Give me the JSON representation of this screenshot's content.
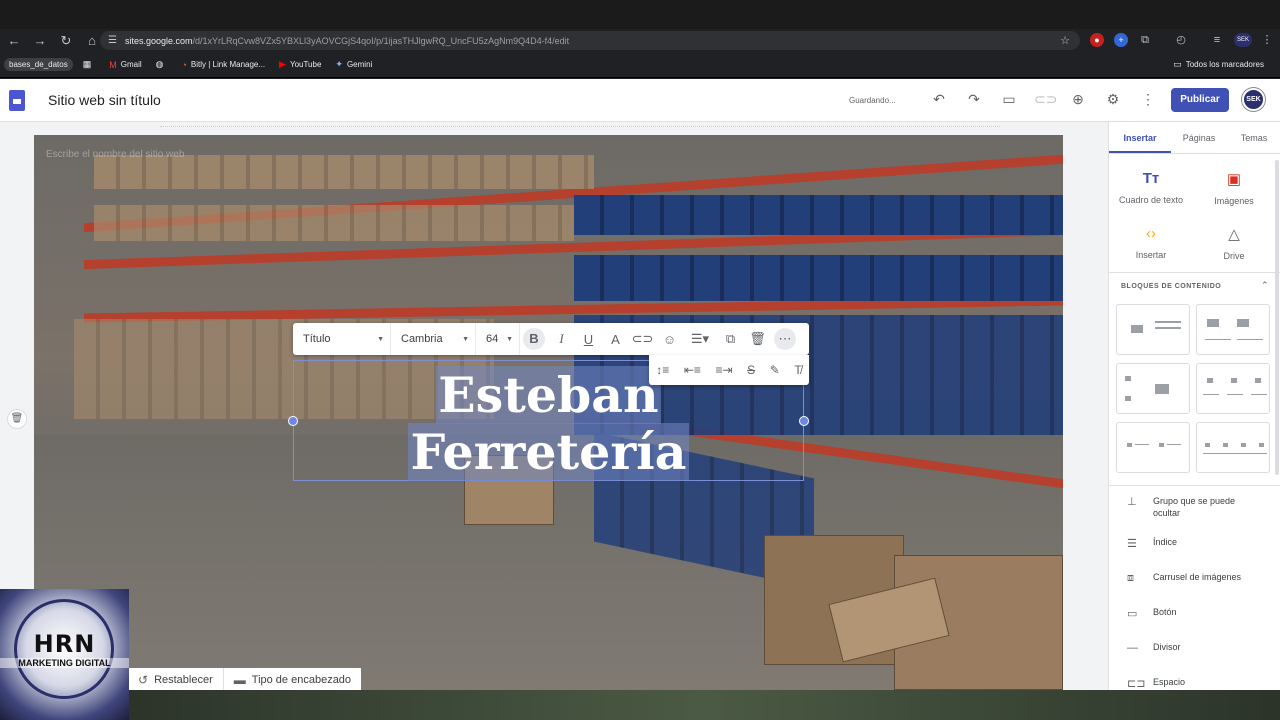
{
  "browser": {
    "url_host": "sites.google.com",
    "url_path": "/d/1xYrLRqCvw8VZx5YBXLl3yAOVCGjS4qoI/p/1ijasTHJlgwRQ_UncFU5zAgNm9Q4D4-f4/edit",
    "bookmarks": [
      "bases_de_datos",
      "Gmail",
      "Bitly | Link Manage...",
      "YouTube",
      "Gemini"
    ],
    "all_bookmarks": "Todos los marcadores",
    "avatar_text": "SEK"
  },
  "header": {
    "title": "Sitio web sin título",
    "status": "Guardando...",
    "publish": "Publicar",
    "avatar": "SEK"
  },
  "hero": {
    "site_name_placeholder": "Escribe el nombre del sitio web",
    "headline_line1": "Esteban",
    "headline_line2": "Ferretería"
  },
  "toolbar": {
    "style": "Título",
    "font": "Cambria",
    "size": "64"
  },
  "header_actions": {
    "reset": "Restablecer",
    "header_type": "Tipo de encabezado"
  },
  "panel": {
    "tabs": [
      "Insertar",
      "Páginas",
      "Temas"
    ],
    "insert_items": [
      "Cuadro de texto",
      "Imágenes",
      "Insertar",
      "Drive"
    ],
    "section_title": "BLOQUES DE CONTENIDO",
    "list": [
      "Grupo que se puede ocultar",
      "Índice",
      "Carrusel de imágenes",
      "Botón",
      "Divisor",
      "Espacio"
    ]
  },
  "watermark": {
    "logo": "HRN",
    "subtitle": "MARKETING DIGITAL"
  },
  "colors": {
    "accent": "#3f51b5",
    "selection": "#7186c6"
  }
}
